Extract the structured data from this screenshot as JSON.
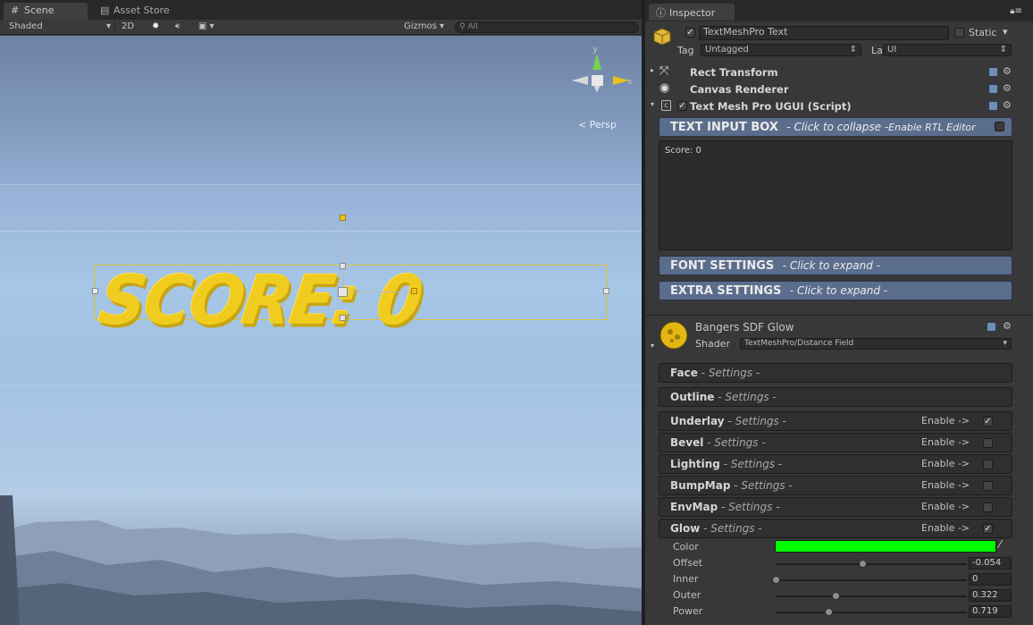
{
  "scene_tabs": {
    "scene": "Scene",
    "asset_store": "Asset Store"
  },
  "scene_toolbar": {
    "shading": "Shaded",
    "mode_2d": "2D",
    "gizmos": "Gizmos",
    "search_placeholder": "All"
  },
  "viewport": {
    "score_text": "SCORE: 0",
    "persp_label": "Persp",
    "axis_y": "y",
    "axis_x": "x"
  },
  "inspector": {
    "tab": "Inspector",
    "object_name": "TextMeshPro Text",
    "static_label": "Static",
    "tag_label": "Tag",
    "tag_value": "Untagged",
    "layer_label": "Layer",
    "layer_value": "UI",
    "components": [
      "Rect Transform",
      "Canvas Renderer",
      "Text Mesh Pro UGUI (Script)"
    ],
    "text_input_title": "TEXT INPUT BOX",
    "text_input_hint": "- Click to collapse -",
    "rtl_label": "Enable RTL Editor",
    "text_value": "Score: 0",
    "font_settings_title": "FONT SETTINGS",
    "font_settings_hint": "- Click to expand -",
    "extra_settings_title": "EXTRA SETTINGS",
    "extra_settings_hint": "- Click to expand -",
    "material_name": "Bangers SDF Glow",
    "shader_label": "Shader",
    "shader_value": "TextMeshPro/Distance Field",
    "settings_suffix": "- Settings -",
    "enable_label": "Enable ->",
    "material_sections": [
      {
        "name": "Face",
        "has_enable": false,
        "enabled": false
      },
      {
        "name": "Outline",
        "has_enable": false,
        "enabled": false
      },
      {
        "name": "Underlay",
        "has_enable": true,
        "enabled": true
      },
      {
        "name": "Bevel",
        "has_enable": true,
        "enabled": false
      },
      {
        "name": "Lighting",
        "has_enable": true,
        "enabled": false
      },
      {
        "name": "BumpMap",
        "has_enable": true,
        "enabled": false
      },
      {
        "name": "EnvMap",
        "has_enable": true,
        "enabled": false
      },
      {
        "name": "Glow",
        "has_enable": true,
        "enabled": true
      }
    ],
    "glow": {
      "color_label": "Color",
      "color_value": "#00ff00",
      "props": [
        {
          "label": "Offset",
          "value": "-0.054",
          "fraction": 0.46
        },
        {
          "label": "Inner",
          "value": "0",
          "fraction": 0.0
        },
        {
          "label": "Outer",
          "value": "0.322",
          "fraction": 0.32
        },
        {
          "label": "Power",
          "value": "0.719",
          "fraction": 0.28
        }
      ]
    }
  },
  "colors": {
    "section_header": "#5b6d8c",
    "score_yellow": "#f0cc1e",
    "glow_green": "#00ff00"
  }
}
